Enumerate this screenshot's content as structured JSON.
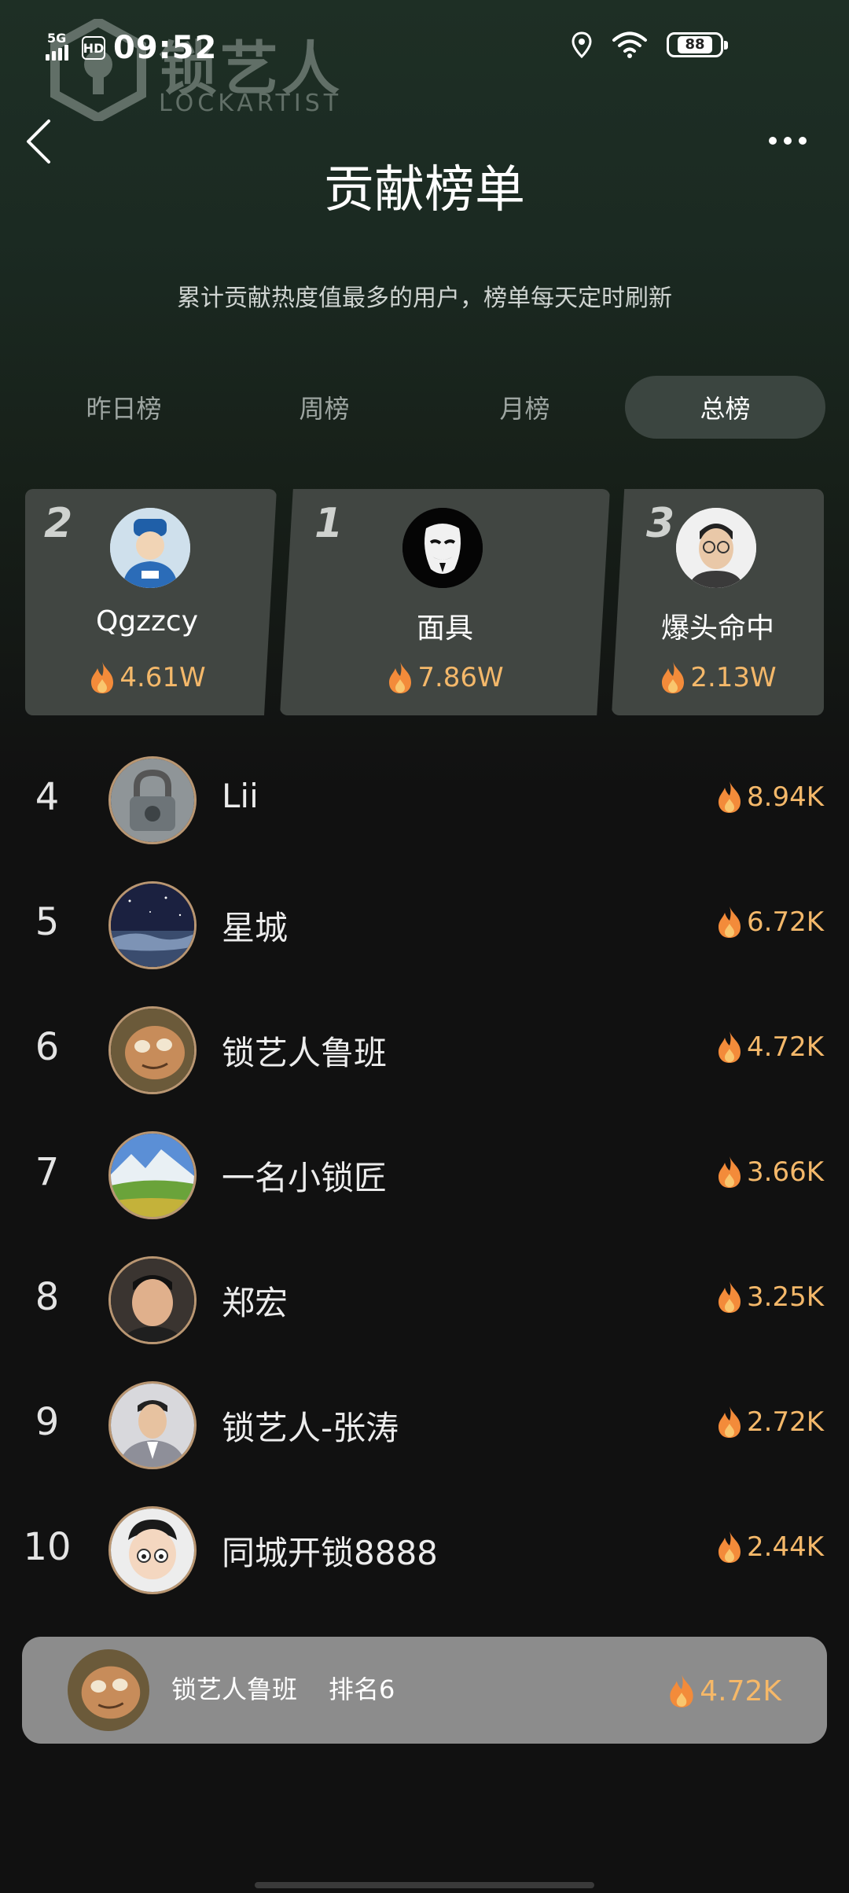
{
  "status_bar": {
    "network": "5G",
    "hd": "HD",
    "time": "09:52",
    "battery": "88"
  },
  "watermark": {
    "cn": "锁艺人",
    "en": "LOCKARTIST"
  },
  "header": {
    "title": "贡献榜单",
    "subtitle": "累计贡献热度值最多的用户，榜单每天定时刷新"
  },
  "tabs": [
    {
      "label": "昨日榜",
      "active": false
    },
    {
      "label": "周榜",
      "active": false
    },
    {
      "label": "月榜",
      "active": false
    },
    {
      "label": "总榜",
      "active": true
    }
  ],
  "podium": {
    "first": {
      "rank": "1",
      "name": "面具",
      "value": "7.86W"
    },
    "second": {
      "rank": "2",
      "name": "Qgzzcy",
      "value": "4.61W"
    },
    "third": {
      "rank": "3",
      "name": "爆头命中",
      "value": "2.13W"
    }
  },
  "ranking": [
    {
      "rank": "4",
      "name": "Lii",
      "value": "8.94K"
    },
    {
      "rank": "5",
      "name": "星城",
      "value": "6.72K"
    },
    {
      "rank": "6",
      "name": "锁艺人鲁班",
      "value": "4.72K"
    },
    {
      "rank": "7",
      "name": "一名小锁匠",
      "value": "3.66K"
    },
    {
      "rank": "8",
      "name": "郑宏",
      "value": "3.25K"
    },
    {
      "rank": "9",
      "name": "锁艺人-张涛",
      "value": "2.72K"
    },
    {
      "rank": "10",
      "name": "同城开锁8888",
      "value": "2.44K"
    }
  ],
  "my_rank": {
    "name": "锁艺人鲁班",
    "rank_text": "排名6",
    "value": "4.72K"
  },
  "colors": {
    "accent": "#f4b86a",
    "tab_active": "#3b4540",
    "card": "#414642"
  }
}
